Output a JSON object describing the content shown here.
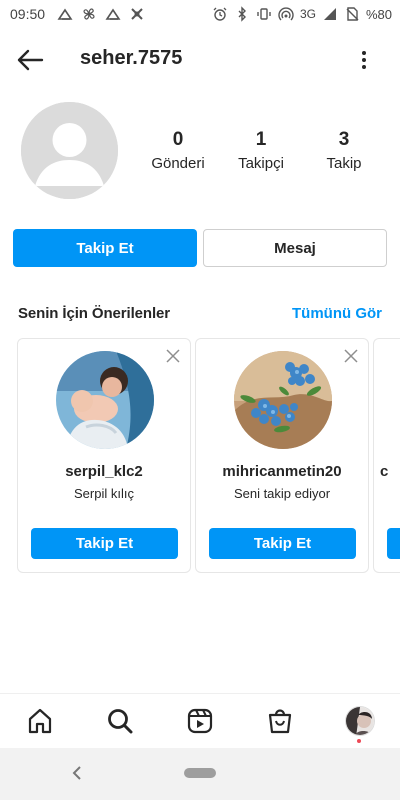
{
  "status_bar": {
    "time": "09:50",
    "network": "3G",
    "battery": "%80"
  },
  "header": {
    "username": "seher.7575"
  },
  "profile": {
    "stats": [
      {
        "value": "0",
        "label": "Gönderi"
      },
      {
        "value": "1",
        "label": "Takipçi"
      },
      {
        "value": "3",
        "label": "Takip"
      }
    ]
  },
  "actions": {
    "follow_label": "Takip Et",
    "message_label": "Mesaj"
  },
  "suggestions": {
    "title": "Senin İçin Önerilenler",
    "see_all": "Tümünü Gör",
    "cards": [
      {
        "username": "serpil_klc2",
        "subtitle": "Serpil kılıç",
        "button": "Takip Et"
      },
      {
        "username": "mihricanmetin20",
        "subtitle": "Seni takip ediyor",
        "button": "Takip Et"
      },
      {
        "username": "c",
        "subtitle": "",
        "button": ""
      }
    ]
  },
  "bottom_nav": {
    "items": [
      "home-icon",
      "search-icon",
      "reels-icon",
      "shop-icon",
      "profile-avatar"
    ]
  },
  "colors": {
    "accent": "#0095f6",
    "text": "#262626",
    "notification_dot": "#ed4956"
  }
}
